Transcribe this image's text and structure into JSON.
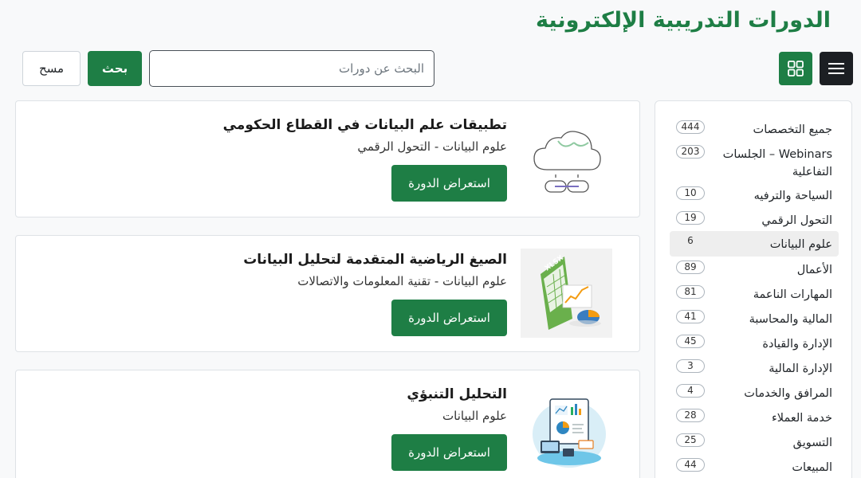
{
  "page": {
    "title": "الدورات التدريبية الإلكترونية"
  },
  "toolbar": {
    "menu_icon": "hamburger-icon",
    "grid_icon": "grid-icon",
    "search_placeholder": "البحث عن دورات",
    "search_value": "",
    "search_label": "بحث",
    "clear_label": "مسح"
  },
  "colors": {
    "brand_green": "#1e7e45",
    "dark": "#1c1f23"
  },
  "categories": [
    {
      "label": "جميع التخصصات",
      "count": "444"
    },
    {
      "label": "Webinars – الجلسات التفاعلية",
      "count": "203"
    },
    {
      "label": "السياحة والترفيه",
      "count": "10"
    },
    {
      "label": "التحول الرقمي",
      "count": "19"
    },
    {
      "label": "علوم البيانات",
      "count": "6",
      "active": true
    },
    {
      "label": "الأعمال",
      "count": "89"
    },
    {
      "label": "المهارات الناعمة",
      "count": "81"
    },
    {
      "label": "المالية والمحاسبة",
      "count": "41"
    },
    {
      "label": "الإدارة والقيادة",
      "count": "45"
    },
    {
      "label": "الإدارة المالية",
      "count": "3"
    },
    {
      "label": "المرافق والخدمات",
      "count": "4"
    },
    {
      "label": "خدمة العملاء",
      "count": "28"
    },
    {
      "label": "التسويق",
      "count": "25"
    },
    {
      "label": "المبيعات",
      "count": "44"
    }
  ],
  "courses": [
    {
      "title": "تطبيقات علم البيانات في القطاع الحكومي",
      "subtitle": "علوم البيانات - التحول الرقمي",
      "button": "استعراض الدورة",
      "icon": "cloud-link-icon"
    },
    {
      "title": "الصيغ الرياضية المتقدمة لتحليل البيانات",
      "subtitle": "علوم البيانات - تقنية المعلومات والاتصالات",
      "button": "استعراض الدورة",
      "icon": "xlsx-file-icon"
    },
    {
      "title": "التحليل التنبؤي",
      "subtitle": "علوم البيانات",
      "button": "استعراض الدورة",
      "icon": "analytics-dashboard-icon"
    }
  ]
}
